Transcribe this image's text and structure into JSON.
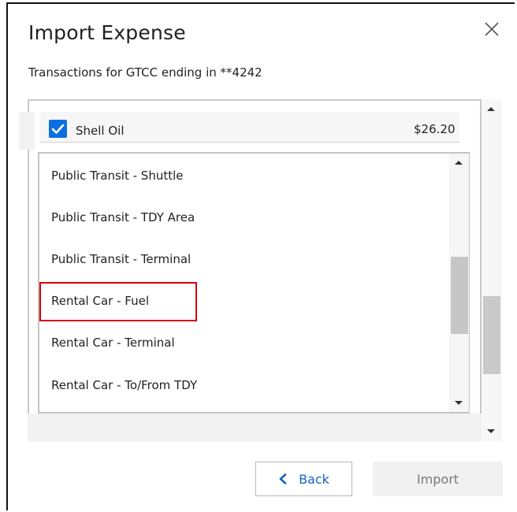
{
  "dialog": {
    "title": "Import Expense",
    "subtitle": "Transactions for GTCC ending in **4242",
    "close_icon": "close-icon"
  },
  "transaction": {
    "name": "Shell Oil",
    "amount": "$26.20",
    "checked": true,
    "check_color": "#0d6ee0"
  },
  "dropdown": {
    "options": [
      "Public Transit - Shuttle",
      "Public Transit - TDY Area",
      "Public Transit - Terminal",
      "Rental Car - Fuel",
      "Rental Car - Terminal",
      "Rental Car - To/From TDY"
    ],
    "highlighted": "Rental Car - Fuel",
    "highlight_color": "#d4000c"
  },
  "buttons": {
    "back": "Back",
    "import": "Import",
    "back_color": "#1463c7"
  }
}
